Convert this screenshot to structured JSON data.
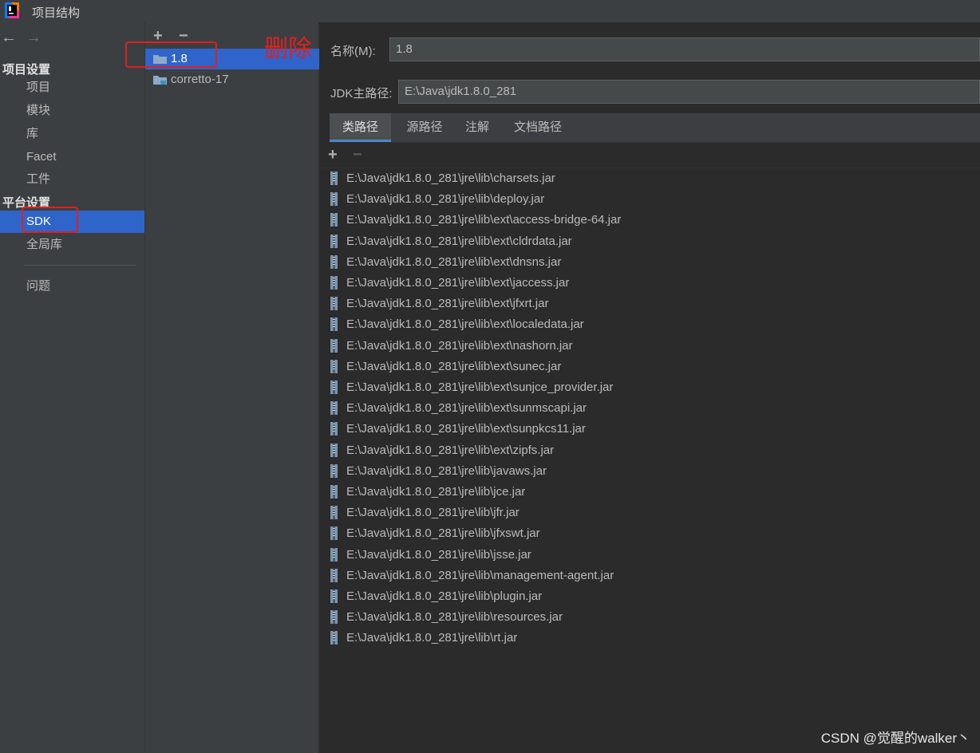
{
  "window": {
    "title": "项目结构"
  },
  "nav": {
    "back_icon": "arrow-left-icon",
    "forward_icon": "arrow-right-icon",
    "project_settings_header": "项目设置",
    "project_settings": [
      "项目",
      "模块",
      "库",
      "Facet",
      "工件"
    ],
    "platform_settings_header": "平台设置",
    "platform_settings": [
      "SDK",
      "全局库"
    ],
    "problems": "问题",
    "selected": "SDK"
  },
  "sdk_list": {
    "add_label": "+",
    "remove_label": "−",
    "items": [
      "1.8",
      "corretto-17"
    ],
    "selected": "1.8"
  },
  "annotation": {
    "delete_text": "删除",
    "color": "#e02020"
  },
  "details": {
    "name_label": "名称(M):",
    "name_value": "1.8",
    "home_label": "JDK主路径:",
    "home_value": "E:\\Java\\jdk1.8.0_281",
    "tabs": [
      "类路径",
      "源路径",
      "注解",
      "文档路径"
    ],
    "active_tab": "类路径",
    "list_add": "+",
    "list_remove": "−",
    "classpath": [
      "E:\\Java\\jdk1.8.0_281\\jre\\lib\\charsets.jar",
      "E:\\Java\\jdk1.8.0_281\\jre\\lib\\deploy.jar",
      "E:\\Java\\jdk1.8.0_281\\jre\\lib\\ext\\access-bridge-64.jar",
      "E:\\Java\\jdk1.8.0_281\\jre\\lib\\ext\\cldrdata.jar",
      "E:\\Java\\jdk1.8.0_281\\jre\\lib\\ext\\dnsns.jar",
      "E:\\Java\\jdk1.8.0_281\\jre\\lib\\ext\\jaccess.jar",
      "E:\\Java\\jdk1.8.0_281\\jre\\lib\\ext\\jfxrt.jar",
      "E:\\Java\\jdk1.8.0_281\\jre\\lib\\ext\\localedata.jar",
      "E:\\Java\\jdk1.8.0_281\\jre\\lib\\ext\\nashorn.jar",
      "E:\\Java\\jdk1.8.0_281\\jre\\lib\\ext\\sunec.jar",
      "E:\\Java\\jdk1.8.0_281\\jre\\lib\\ext\\sunjce_provider.jar",
      "E:\\Java\\jdk1.8.0_281\\jre\\lib\\ext\\sunmscapi.jar",
      "E:\\Java\\jdk1.8.0_281\\jre\\lib\\ext\\sunpkcs11.jar",
      "E:\\Java\\jdk1.8.0_281\\jre\\lib\\ext\\zipfs.jar",
      "E:\\Java\\jdk1.8.0_281\\jre\\lib\\javaws.jar",
      "E:\\Java\\jdk1.8.0_281\\jre\\lib\\jce.jar",
      "E:\\Java\\jdk1.8.0_281\\jre\\lib\\jfr.jar",
      "E:\\Java\\jdk1.8.0_281\\jre\\lib\\jfxswt.jar",
      "E:\\Java\\jdk1.8.0_281\\jre\\lib\\jsse.jar",
      "E:\\Java\\jdk1.8.0_281\\jre\\lib\\management-agent.jar",
      "E:\\Java\\jdk1.8.0_281\\jre\\lib\\plugin.jar",
      "E:\\Java\\jdk1.8.0_281\\jre\\lib\\resources.jar",
      "E:\\Java\\jdk1.8.0_281\\jre\\lib\\rt.jar"
    ]
  },
  "watermark": "CSDN @觉醒的walker丶"
}
